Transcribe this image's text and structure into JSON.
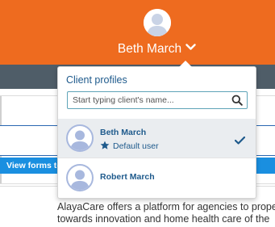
{
  "header": {
    "user_name": "Beth March",
    "avatar_icon": "user-avatar-icon",
    "menu_icon": "chevron-down-icon",
    "color": "#ee6b1f"
  },
  "background": {
    "view_forms_label": "View forms to",
    "body_text_line1": "AlayaCare offers a platform for agencies to propel",
    "body_text_line2": "towards innovation and home health care of the"
  },
  "dropdown": {
    "title": "Client profiles",
    "search": {
      "placeholder": "Start typing client's name...",
      "value": "",
      "icon": "search-icon"
    },
    "profiles": [
      {
        "name": "Beth March",
        "default_label": "Default user",
        "selected": true,
        "badge_icon": "star-icon",
        "check_icon": "check-icon"
      },
      {
        "name": "Robert March",
        "default_label": "",
        "selected": false
      }
    ],
    "accent_color": "#1e5a8c"
  }
}
